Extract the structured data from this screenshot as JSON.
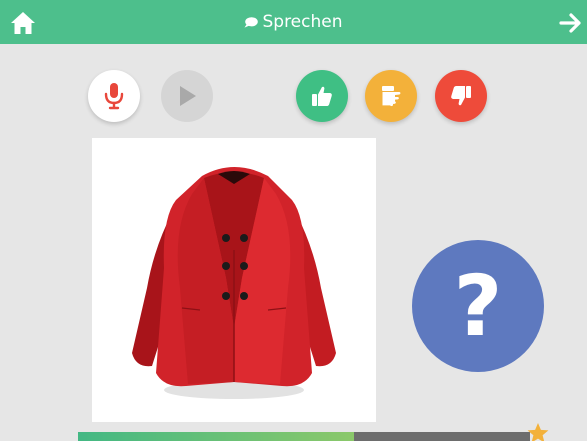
{
  "topbar": {
    "title": "Sprechen",
    "home_icon": "home-icon",
    "title_icon": "speech-bubble-icon",
    "next_icon": "arrow-right-icon",
    "color": "#4dbf8c"
  },
  "controls": {
    "record_icon": "microphone-icon",
    "play_icon": "play-icon",
    "rating": [
      {
        "icon": "thumb-up-icon",
        "color": "#3fbf84"
      },
      {
        "icon": "thumb-sideways-icon",
        "color": "#f3b13a"
      },
      {
        "icon": "thumb-down-icon",
        "color": "#ee4b3a"
      }
    ]
  },
  "card": {
    "image": "red-coat"
  },
  "hint": {
    "symbol": "?",
    "color": "#5e79bf"
  },
  "progress": {
    "fraction": 0.61,
    "star_icon": "star-icon"
  }
}
